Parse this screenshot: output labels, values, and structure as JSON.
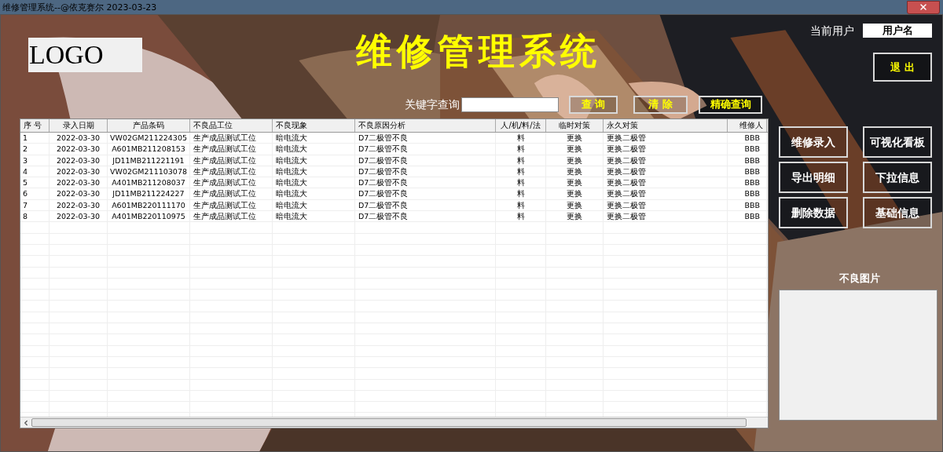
{
  "window": {
    "title": "维修管理系统--@依克赛尔 2023-03-23"
  },
  "logo": "LOGO",
  "app_title": "维修管理系统",
  "user": {
    "label": "当前用户",
    "value": "用户名"
  },
  "exit_button": "退 出",
  "search": {
    "label": "关键字查询",
    "buttons": [
      "查 询",
      "清 除",
      "精确查询"
    ]
  },
  "table": {
    "columns": [
      "序 号",
      "录入日期",
      "产品条码",
      "不良品工位",
      "不良现象",
      "不良原因分析",
      "人/机/料/法",
      "临时对策",
      "永久对策",
      "维修人"
    ],
    "rows": [
      [
        "1",
        "2022-03-30",
        "VW02GM211224305",
        "生产成品测试工位",
        "暗电流大",
        "D7二极管不良",
        "料",
        "更换",
        "更换二极管",
        "BBB"
      ],
      [
        "2",
        "2022-03-30",
        "A601MB211208153",
        "生产成品测试工位",
        "暗电流大",
        "D7二极管不良",
        "料",
        "更换",
        "更换二极管",
        "BBB"
      ],
      [
        "3",
        "2022-03-30",
        "JD11MB211221191",
        "生产成品测试工位",
        "暗电流大",
        "D7二极管不良",
        "料",
        "更换",
        "更换二极管",
        "BBB"
      ],
      [
        "4",
        "2022-03-30",
        "VW02GM211103078",
        "生产成品测试工位",
        "暗电流大",
        "D7二极管不良",
        "料",
        "更换",
        "更换二极管",
        "BBB"
      ],
      [
        "5",
        "2022-03-30",
        "A401MB211208037",
        "生产成品测试工位",
        "暗电流大",
        "D7二极管不良",
        "料",
        "更换",
        "更换二极管",
        "BBB"
      ],
      [
        "6",
        "2022-03-30",
        "JD11MB211224227",
        "生产成品测试工位",
        "暗电流大",
        "D7二极管不良",
        "料",
        "更换",
        "更换二极管",
        "BBB"
      ],
      [
        "7",
        "2022-03-30",
        "A601MB220111170",
        "生产成品测试工位",
        "暗电流大",
        "D7二极管不良",
        "料",
        "更换",
        "更换二极管",
        "BBB"
      ],
      [
        "8",
        "2022-03-30",
        "A401MB220110975",
        "生产成品测试工位",
        "暗电流大",
        "D7二极管不良",
        "料",
        "更换",
        "更换二极管",
        "BBB"
      ]
    ]
  },
  "actions": [
    "维修录入",
    "可视化看板",
    "导出明细",
    "下拉信息",
    "删除数据",
    "基础信息"
  ],
  "image_panel": {
    "label": "不良图片"
  }
}
